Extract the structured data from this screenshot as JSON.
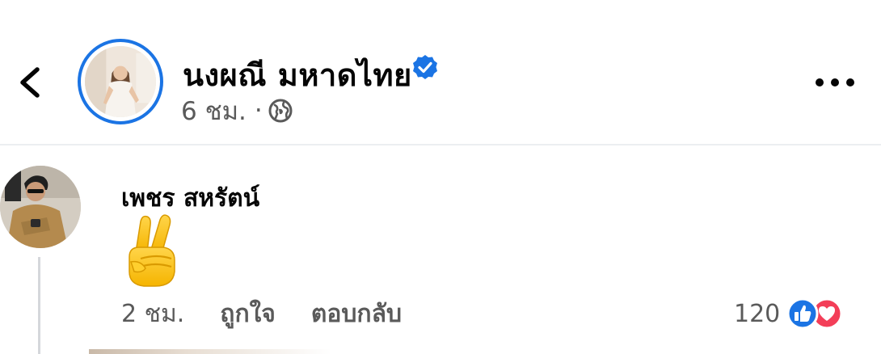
{
  "post_header": {
    "author_name": "นงผณี มหาดไทย",
    "time": "6 ชม.",
    "separator": "·",
    "back_icon": "chevron-left-icon",
    "verified_icon": "verified-badge-icon",
    "audience_icon": "globe-icon",
    "more_icon": "more-horizontal-icon"
  },
  "comment": {
    "author_name": "เพชร สหรัตน์",
    "emoji": "✌️",
    "time": "2 ชม.",
    "like_label": "ถูกใจ",
    "reply_label": "ตอบกลับ",
    "reaction_count": "120",
    "reactions": [
      "like",
      "love"
    ]
  },
  "colors": {
    "accent_blue": "#1b74e4",
    "love_red": "#f33e58",
    "secondary_text": "#5a5a5a",
    "divider": "#eceef1"
  }
}
